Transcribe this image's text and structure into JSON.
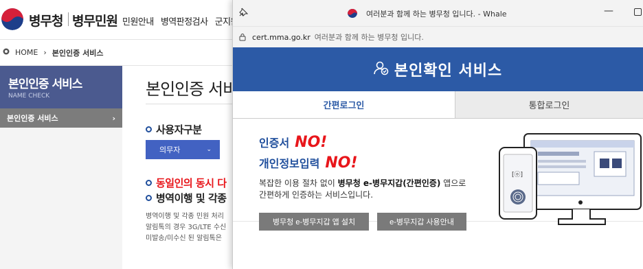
{
  "site": {
    "logo_text_1": "병무청",
    "logo_text_2": "병무민원",
    "nav": [
      "민원안내",
      "병역판정검사",
      "군지원"
    ]
  },
  "breadcrumb": {
    "home": "HOME",
    "current": "본인인증 서비스"
  },
  "lnb": {
    "title": "본인인증 서비스",
    "subtitle": "NAME CHECK",
    "active_item": "본인인증 서비스"
  },
  "content": {
    "page_title": "본인인증 서비",
    "user_type_heading": "사용자구분",
    "user_type_value": "의무자",
    "notice_red": "동일인의 동시 다",
    "notice_black": "병역이행 및 각종",
    "desc_lines": [
      "병역이행 및 각종 민원 처리",
      "알림톡의 경우 3G/LTE 수신",
      "미발송/미수신 된 알림톡은"
    ]
  },
  "popup": {
    "window_title": "여러분과 함께 하는 병무청 입니다. - Whale",
    "url": "cert.mma.go.kr",
    "page_title_in_address": "여러분과 함께 하는 병무청 입니다.",
    "banner_title": "본인확인 서비스",
    "tabs": [
      {
        "label": "간편로그인",
        "active": true
      },
      {
        "label": "통합로그인",
        "active": false
      }
    ],
    "cert_label": "인증서",
    "personal_info_label": "개인정보입력",
    "no_word": "NO!",
    "body_text_part1": "복잡한 이용 절차 없이 ",
    "body_text_bold": "병무청 e-병무지갑(간편인증)",
    "body_text_part2": " 앱으로",
    "body_text_line2": "간편하게 인증하는 서비스입니다.",
    "install_button": "병무청 e-병무지갑 앱 설치",
    "guide_button": "e-병무지갑 사용안내"
  },
  "colors": {
    "banner_blue": "#2c5aa6",
    "accent_red": "#e8161b",
    "lnb_header": "#4b5a8f"
  }
}
